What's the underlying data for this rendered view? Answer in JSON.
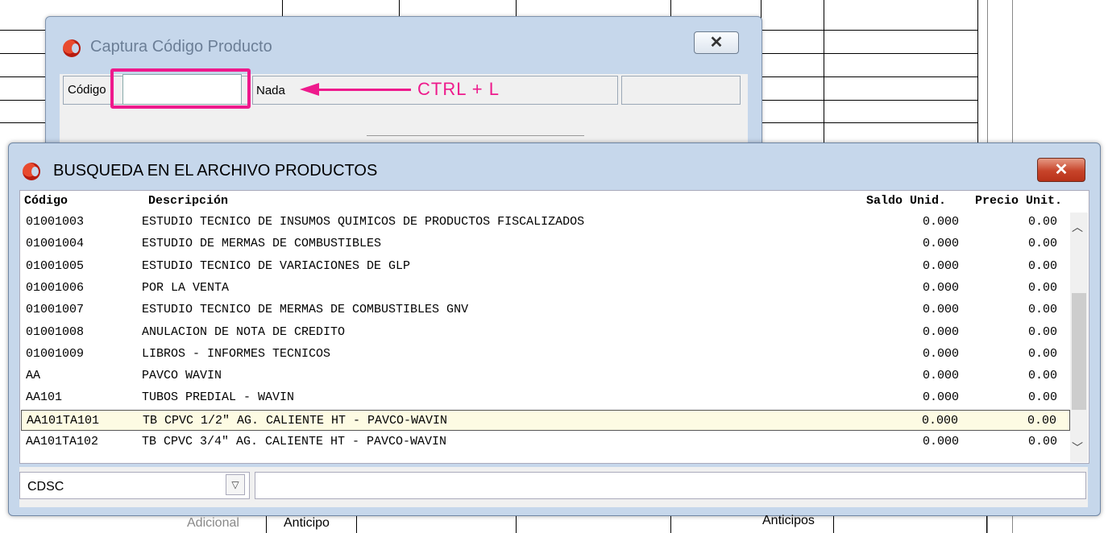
{
  "captura": {
    "title": "Captura Código Producto",
    "close_icon": "close-icon",
    "codigo_label": "Código",
    "codigo_value": "",
    "nada_label": "Nada",
    "annotation": "CTRL + L",
    "annotation_color": "#ee1a8c"
  },
  "busqueda": {
    "title": "BUSQUEDA EN EL ARCHIVO PRODUCTOS",
    "columns": [
      "Código",
      "Descripción",
      "Saldo Unid.",
      "Precio Unit."
    ],
    "rows": [
      {
        "code": "01001003",
        "desc": "ESTUDIO TECNICO DE INSUMOS QUIMICOS DE PRODUCTOS FISCALIZADOS",
        "saldo": "0.000",
        "precio": "0.00"
      },
      {
        "code": "01001004",
        "desc": "ESTUDIO DE MERMAS DE COMBUSTIBLES",
        "saldo": "0.000",
        "precio": "0.00"
      },
      {
        "code": "01001005",
        "desc": "ESTUDIO TECNICO DE VARIACIONES DE GLP",
        "saldo": "0.000",
        "precio": "0.00"
      },
      {
        "code": "01001006",
        "desc": "POR LA VENTA",
        "saldo": "0.000",
        "precio": "0.00"
      },
      {
        "code": "01001007",
        "desc": "ESTUDIO TECNICO DE MERMAS DE COMBUSTIBLES GNV",
        "saldo": "0.000",
        "precio": "0.00"
      },
      {
        "code": "01001008",
        "desc": "ANULACION DE NOTA DE CREDITO",
        "saldo": "0.000",
        "precio": "0.00"
      },
      {
        "code": "01001009",
        "desc": "LIBROS - INFORMES TECNICOS",
        "saldo": "0.000",
        "precio": "0.00"
      },
      {
        "code": "AA",
        "desc": "PAVCO WAVIN",
        "saldo": "0.000",
        "precio": "0.00"
      },
      {
        "code": "AA101",
        "desc": "TUBOS PREDIAL - WAVIN",
        "saldo": "0.000",
        "precio": "0.00"
      },
      {
        "code": "AA101TA101",
        "desc": "TB CPVC 1/2\" AG. CALIENTE HT - PAVCO-WAVIN",
        "saldo": "0.000",
        "precio": "0.00"
      },
      {
        "code": "AA101TA102",
        "desc": "TB CPVC 3/4\" AG. CALIENTE HT - PAVCO-WAVIN",
        "saldo": "0.000",
        "precio": "0.00"
      }
    ],
    "selected_row": 9,
    "search_field": "CDSC",
    "search_text": ""
  },
  "background": {
    "tabs": [
      "Adicional",
      "Anticipo",
      "Anticipos"
    ]
  }
}
